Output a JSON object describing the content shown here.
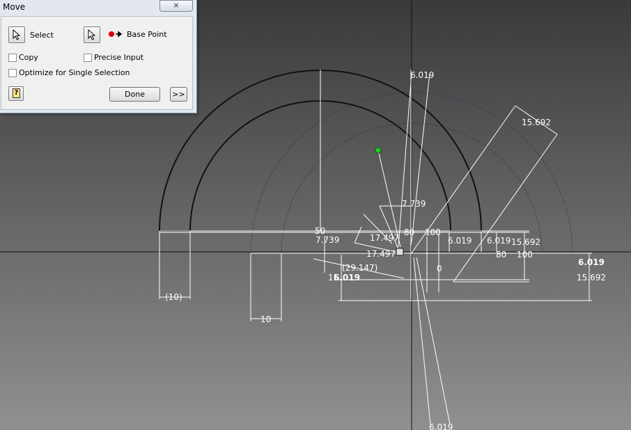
{
  "dialog": {
    "title": "Move",
    "close_glyph": "⨯",
    "select_label": "Select",
    "base_point_label": "Base Point",
    "copy_label": "Copy",
    "precise_input_label": "Precise Input",
    "optimize_label": "Optimize for Single Selection",
    "done_label": "Done",
    "expand_label": ">>",
    "help_glyph": "?",
    "copy_checked": false,
    "precise_input_checked": false,
    "optimize_checked": false
  },
  "sketch": {
    "colors": {
      "background_top": "#3a3a3a",
      "background_bottom": "#909090",
      "geometry": "#111111",
      "dimension": "#ffffff",
      "construction": "#1f2a66",
      "point": "#22cc22"
    },
    "dims": {
      "d_top": "6.019",
      "d_bottom": "6.019",
      "d_diag": "15.692",
      "d_7739_a": "7.739",
      "d_7739_b": "7.739",
      "d_50": "50",
      "d_80_a": "80",
      "d_80_b": "80",
      "d_100_a": "100",
      "d_100_b": "100",
      "d_17497_a": "17.497",
      "d_17497_b": "17.497",
      "d_6019_a": "6.019",
      "d_6019_b": "6.019",
      "d_15692_a": "15.692",
      "d_6019_bold": "6.019",
      "d_15692_b": "15.692",
      "d_29147": "(29.147)",
      "d_15_left": "15",
      "d_6019_left": "6.019",
      "d_0": "0",
      "d_10_paren": "(10)",
      "d_10": "10"
    }
  }
}
